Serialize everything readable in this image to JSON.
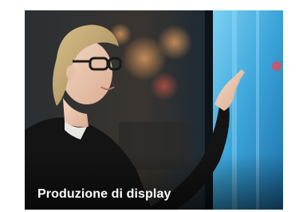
{
  "card": {
    "caption": "Produzione di display",
    "image_subject": "woman-touching-display-photo"
  },
  "colors": {
    "caption_text": "#ffffff",
    "screen_glow": "#4fb6e6",
    "background": "#ffffff"
  }
}
